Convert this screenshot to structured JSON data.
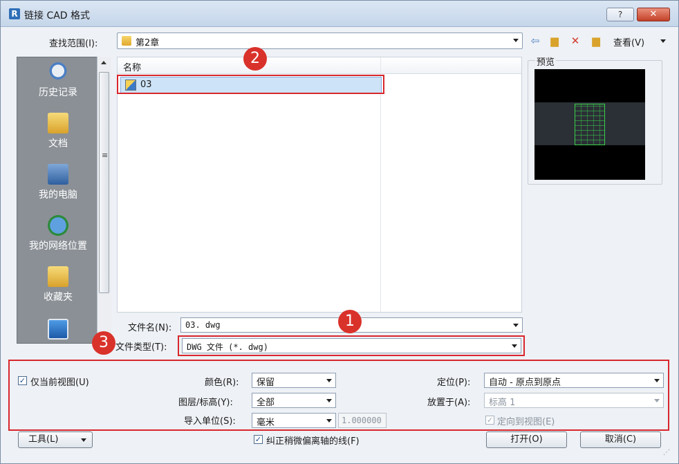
{
  "window": {
    "title": "链接 CAD 格式",
    "app_icon": "R"
  },
  "lookin": {
    "label": "查找范围(I):",
    "value": "第2章"
  },
  "toolbar": {
    "view_label": "查看(V)",
    "icons": [
      "back-icon",
      "up-folder-icon",
      "delete-icon",
      "new-folder-icon"
    ]
  },
  "places": [
    {
      "label": "历史记录",
      "icon": "history-icon"
    },
    {
      "label": "文档",
      "icon": "documents-icon"
    },
    {
      "label": "我的电脑",
      "icon": "my-computer-icon"
    },
    {
      "label": "我的网络位置",
      "icon": "network-icon"
    },
    {
      "label": "收藏夹",
      "icon": "favorites-icon"
    },
    {
      "label": "",
      "icon": "desktop-icon"
    }
  ],
  "filelist": {
    "column_name": "名称",
    "files": [
      {
        "name": "03"
      }
    ]
  },
  "preview": {
    "label": "预览"
  },
  "filename": {
    "label": "文件名(N):",
    "value": "03. dwg"
  },
  "filetype": {
    "label": "文件类型(T):",
    "value": "DWG 文件 (*. dwg)"
  },
  "markers": {
    "one": "1",
    "two": "2",
    "three": "3"
  },
  "options": {
    "current_view_only": {
      "label": "仅当前视图(U)",
      "checked": true
    },
    "color": {
      "label": "颜色(R):",
      "value": "保留"
    },
    "layers": {
      "label": "图层/标高(Y):",
      "value": "全部"
    },
    "units": {
      "label": "导入单位(S):",
      "value": "毫米",
      "factor": "1.000000"
    },
    "positioning": {
      "label": "定位(P):",
      "value": "自动 - 原点到原点"
    },
    "place_at": {
      "label": "放置于(A):",
      "value": "标高 1"
    },
    "orient_to_view": {
      "label": "定向到视图(E)",
      "checked": true
    }
  },
  "bottom": {
    "tools_label": "工具(L)",
    "correct_lines": {
      "label": "纠正稍微偏离轴的线(F)",
      "checked": true
    },
    "open_label": "打开(O)",
    "cancel_label": "取消(C)"
  },
  "colors": {
    "highlight": "#d8262c",
    "selection": "#cde3f7",
    "places_bg": "#8b9096"
  }
}
